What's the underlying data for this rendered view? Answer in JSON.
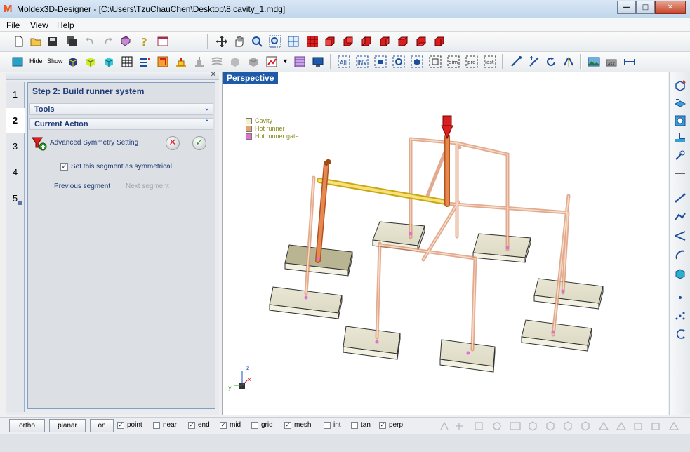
{
  "window": {
    "title": "Moldex3D-Designer - [C:\\Users\\TzuChauChen\\Desktop\\8 cavity_1.mdg]",
    "logo_letter": "M",
    "controls": [
      "—",
      "□",
      "✕"
    ]
  },
  "menu": [
    "File",
    "View",
    "Help"
  ],
  "toolbar2_words": {
    "hide": "Hide",
    "show": "Show"
  },
  "panel": {
    "step_title": "Step 2: Build runner system",
    "tools_header": "Tools",
    "current_action_header": "Current Action",
    "action_label": "Advanced Symmetry Setting",
    "checkbox_label": "Set this segment as symmetrical",
    "checkbox_checked": true,
    "previous_segment": "Previous segment",
    "next_segment": "Next segment",
    "steps": [
      "1",
      "2",
      "3",
      "4",
      "5"
    ],
    "active_step": "2"
  },
  "viewport": {
    "label": "Perspective",
    "legend": [
      {
        "label": "Cavity",
        "color": "#f5f0c8"
      },
      {
        "label": "Hot runner",
        "color": "#e8a070"
      },
      {
        "label": "Hot runner gate",
        "color": "#e070d0"
      }
    ],
    "axes": {
      "x": "x",
      "y": "y",
      "z": "z"
    }
  },
  "snapbar": {
    "ortho": "ortho",
    "planar": "planar",
    "on": "on",
    "options": [
      {
        "label": "point",
        "checked": true
      },
      {
        "label": "near",
        "checked": false
      },
      {
        "label": "end",
        "checked": true
      },
      {
        "label": "mid",
        "checked": true
      },
      {
        "label": "grid",
        "checked": false
      },
      {
        "label": "mesh",
        "checked": true
      },
      {
        "label": "int",
        "checked": false
      },
      {
        "label": "tan",
        "checked": false
      },
      {
        "label": "perp",
        "checked": true
      }
    ]
  },
  "colors": {
    "accent": "#1e5aa8",
    "runner": "#e8a070",
    "runner_edge": "#c06a3a",
    "selected_runner": "#f5d84a",
    "cavity_fill": "#e8e6d0",
    "gate": "#e070d0"
  }
}
